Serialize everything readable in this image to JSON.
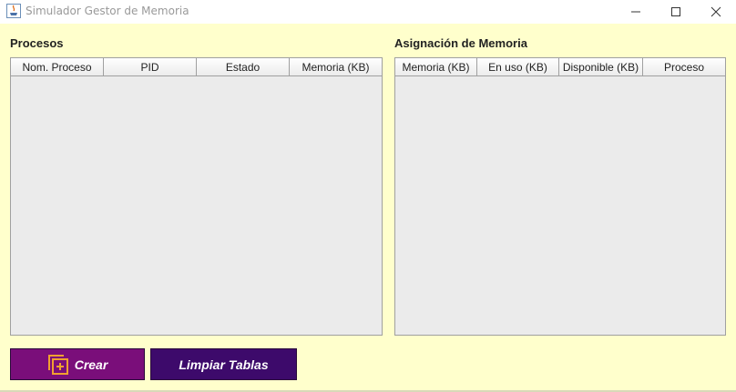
{
  "window": {
    "title": "Simulador Gestor de Memoria"
  },
  "procesos": {
    "title": "Procesos",
    "columns": [
      "Nom. Proceso",
      "PID",
      "Estado",
      "Memoria (KB)"
    ],
    "rows": []
  },
  "asignacion": {
    "title": "Asignación de Memoria",
    "columns": [
      "Memoria (KB)",
      "En uso (KB)",
      "Disponible (KB)",
      "Proceso"
    ],
    "rows": []
  },
  "buttons": {
    "crear_label": "Crear",
    "crear_icon": "add-copy-icon",
    "limpiar_label": "Limpiar Tablas"
  },
  "colors": {
    "background": "#ffffcc",
    "crear_button": "#7a0e7a",
    "limpiar_button": "#3d0a6b",
    "crear_icon": "#f0a030"
  }
}
